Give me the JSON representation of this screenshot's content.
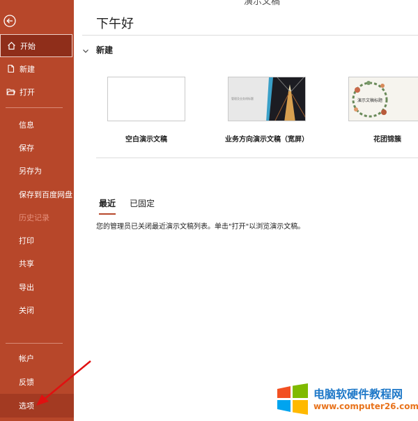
{
  "window": {
    "title": "演示文稿"
  },
  "sidebar": {
    "top": [
      {
        "label": "开始",
        "icon": "home-icon",
        "active": true
      },
      {
        "label": "新建",
        "icon": "new-doc-icon"
      },
      {
        "label": "打开",
        "icon": "open-folder-icon"
      }
    ],
    "middle": [
      {
        "label": "信息"
      },
      {
        "label": "保存"
      },
      {
        "label": "另存为"
      },
      {
        "label": "保存到百度网盘"
      },
      {
        "label": "历史记录",
        "disabled": true
      },
      {
        "label": "打印"
      },
      {
        "label": "共享"
      },
      {
        "label": "导出"
      },
      {
        "label": "关闭"
      }
    ],
    "bottom": [
      {
        "label": "帐户"
      },
      {
        "label": "反馈"
      },
      {
        "label": "选项"
      }
    ]
  },
  "main": {
    "greeting": "下午好",
    "new_section": "新建",
    "templates": [
      {
        "label": "空白演示文稿",
        "thumb_text": ""
      },
      {
        "label": "业务方向演示文稿（宽屏）",
        "thumb_text": "管理及业务线标题"
      },
      {
        "label": "花团锦簇",
        "thumb_text": "演示文稿标题"
      }
    ],
    "tabs": [
      {
        "label": "最近",
        "active": true
      },
      {
        "label": "已固定"
      }
    ],
    "notice": "您的管理员已关闭最近演示文稿列表。单击\"打开\"以浏览演示文稿。"
  },
  "watermark": {
    "line1": "电脑软硬件教程网",
    "line2": "www.computer26.com"
  },
  "colors": {
    "sidebar": "#b7472a",
    "accent": "#b7472a"
  }
}
